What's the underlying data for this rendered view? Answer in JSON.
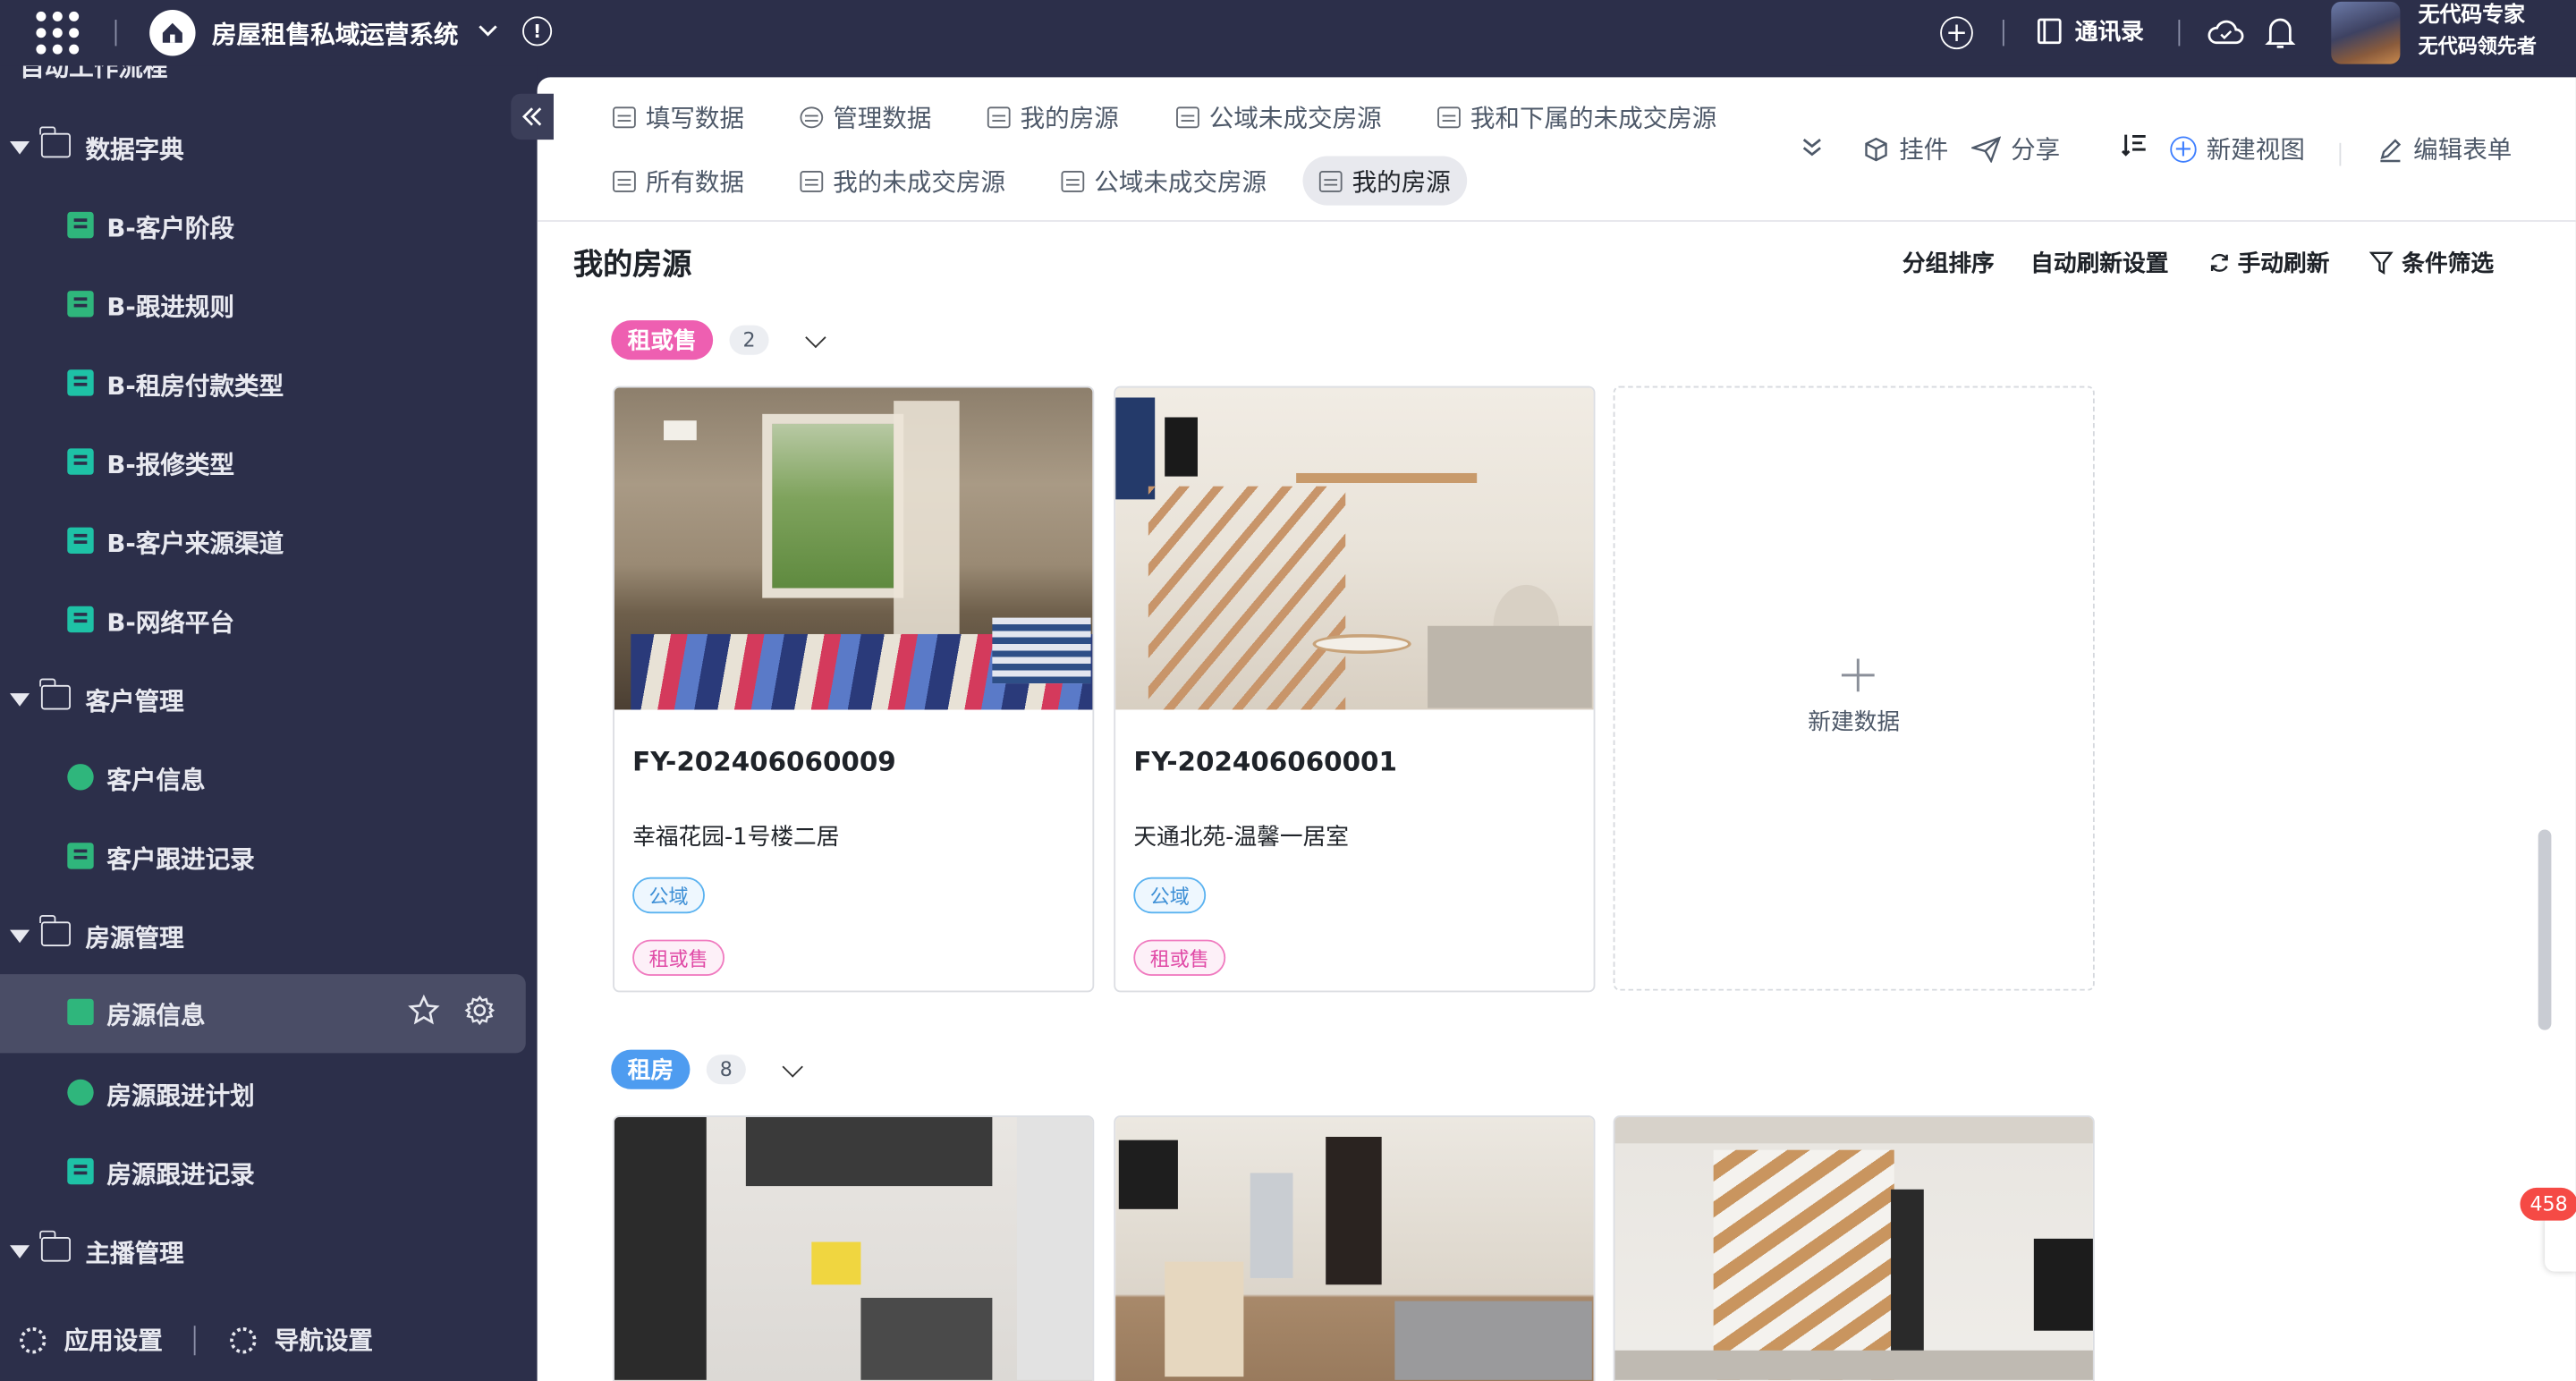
{
  "app": {
    "title": "房屋租售私域运营系统",
    "contacts": "通讯录",
    "user_name": "无代码专家",
    "user_subtitle": "无代码领先者"
  },
  "sidebar": {
    "cut_label": "自动工作流程",
    "folders": [
      {
        "label": "数据字典",
        "items": [
          "B-客户阶段",
          "B-跟进规则",
          "B-租房付款类型",
          "B-报修类型",
          "B-客户来源渠道",
          "B-网络平台"
        ]
      },
      {
        "label": "客户管理",
        "items": [
          "客户信息",
          "客户跟进记录"
        ]
      },
      {
        "label": "房源管理",
        "items": [
          "房源信息",
          "房源跟进计划",
          "房源跟进记录"
        ]
      },
      {
        "label": "主播管理",
        "items": []
      }
    ],
    "active_item": "房源信息",
    "footer": {
      "app_settings": "应用设置",
      "nav_settings": "导航设置"
    }
  },
  "tabs": {
    "row1": [
      "填写数据",
      "管理数据",
      "我的房源",
      "公域未成交房源",
      "我和下属的未成交房源"
    ],
    "row2": [
      "所有数据",
      "我的未成交房源",
      "公域未成交房源",
      "我的房源"
    ],
    "active": "我的房源",
    "tools": {
      "plugins": "挂件",
      "share": "分享",
      "new_view": "新建视图",
      "edit_form": "编辑表单"
    }
  },
  "view": {
    "title": "我的房源",
    "actions": {
      "group_sort": "分组排序",
      "auto_refresh": "自动刷新设置",
      "manual_refresh": "手动刷新",
      "filter": "条件筛选"
    }
  },
  "groups": [
    {
      "tag": "租或售",
      "tag_color": "#ee5fb1",
      "count": "2",
      "cards": [
        {
          "code": "FY-202406060009",
          "title": "幸福花园-1号楼二居",
          "domain_tag": "公域",
          "type_tag": "租或售"
        },
        {
          "code": "FY-202406060001",
          "title": "天通北苑-温馨一居室",
          "domain_tag": "公域",
          "type_tag": "租或售"
        }
      ],
      "new_label": "新建数据"
    },
    {
      "tag": "租房",
      "tag_color": "#4e9cf0",
      "count": "8"
    }
  ],
  "float_badge": "458"
}
